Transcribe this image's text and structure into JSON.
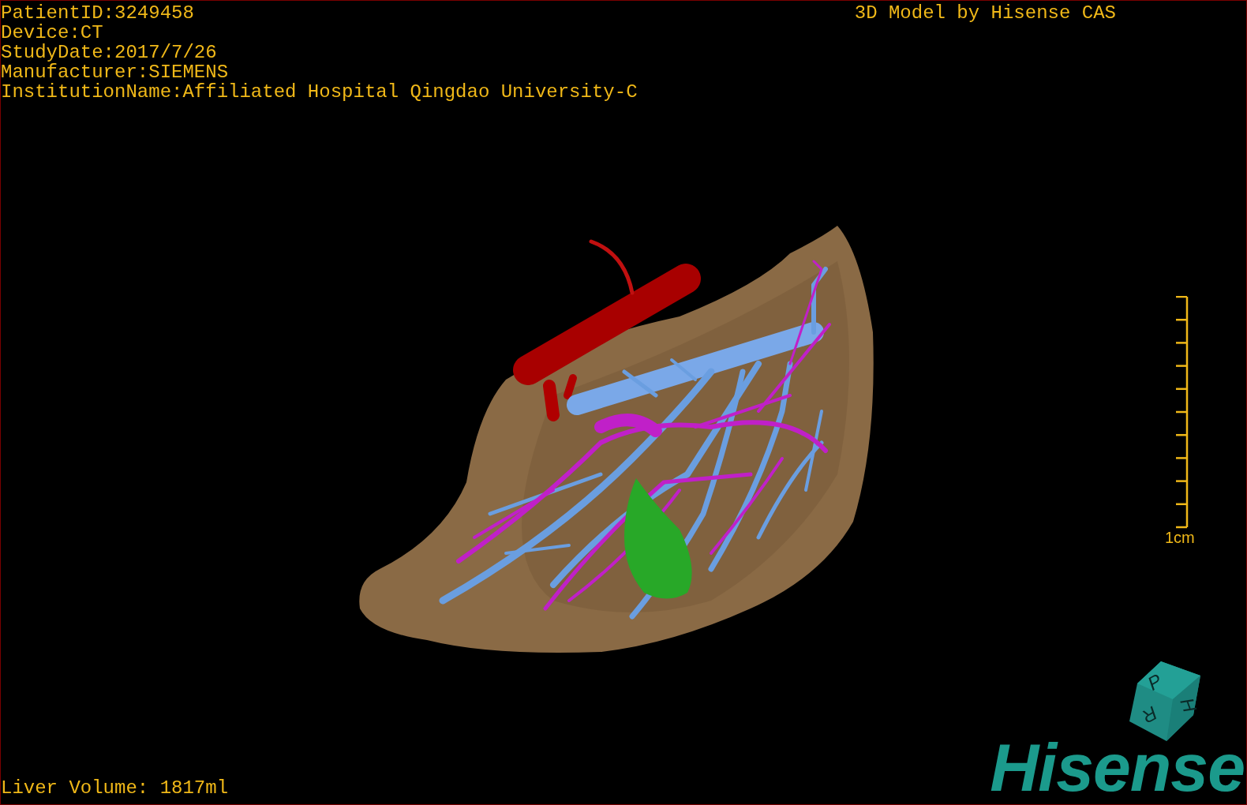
{
  "patient_info": [
    {
      "label": "PatientID:",
      "value": "3249458"
    },
    {
      "label": "Device:",
      "value": "CT"
    },
    {
      "label": "StudyDate:",
      "value": "2017/7/26"
    },
    {
      "label": "Manufacturer:",
      "value": "SIEMENS"
    },
    {
      "label": "InstitutionName:",
      "value": "Affiliated Hospital Qingdao University-C"
    }
  ],
  "title": "3D Model by Hisense CAS",
  "scale_bar": {
    "label": "1cm"
  },
  "orientation_cube": {
    "labels": [
      "P",
      "H",
      "R"
    ]
  },
  "liver_volume": "Liver Volume: 1817ml",
  "logo": "Hisense"
}
